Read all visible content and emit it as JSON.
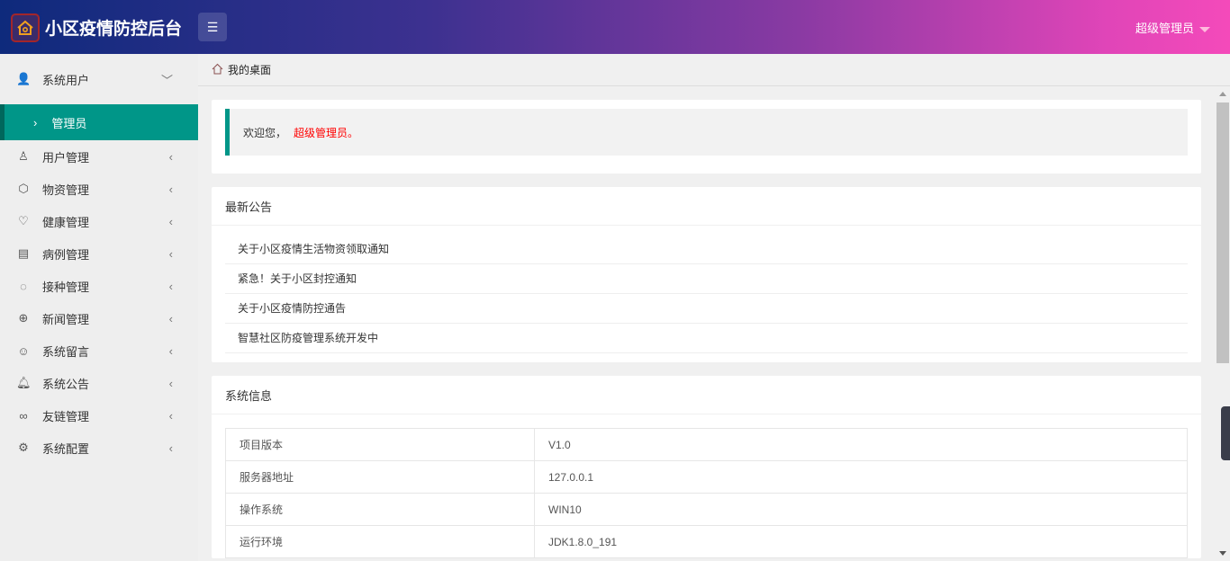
{
  "header": {
    "title": "小区疫情防控后台",
    "user": "超级管理员"
  },
  "sidebar": {
    "top": {
      "label": "系统用户",
      "icon": "user-icon"
    },
    "sub": {
      "label": "管理员"
    },
    "items": [
      {
        "label": "用户管理",
        "icon": "user-outline-icon"
      },
      {
        "label": "物资管理",
        "icon": "box-icon"
      },
      {
        "label": "健康管理",
        "icon": "heart-icon"
      },
      {
        "label": "病例管理",
        "icon": "list-icon"
      },
      {
        "label": "接种管理",
        "icon": "share-icon"
      },
      {
        "label": "新闻管理",
        "icon": "globe-icon"
      },
      {
        "label": "系统留言",
        "icon": "face-icon"
      },
      {
        "label": "系统公告",
        "icon": "bell-icon"
      },
      {
        "label": "友链管理",
        "icon": "link-icon"
      },
      {
        "label": "系统配置",
        "icon": "gear-icon"
      }
    ]
  },
  "breadcrumb": {
    "label": "我的桌面"
  },
  "welcome": {
    "text": "欢迎您，",
    "name": "超级管理员。"
  },
  "notices": {
    "title": "最新公告",
    "items": [
      "关于小区疫情生活物资领取通知",
      "紧急！关于小区封控通知",
      "关于小区疫情防控通告",
      "智慧社区防疫管理系统开发中"
    ]
  },
  "sysinfo": {
    "title": "系统信息",
    "rows": [
      [
        "项目版本",
        "V1.0"
      ],
      [
        "服务器地址",
        "127.0.0.1"
      ],
      [
        "操作系统",
        "WIN10"
      ],
      [
        "运行环境",
        "JDK1.8.0_191"
      ]
    ]
  }
}
